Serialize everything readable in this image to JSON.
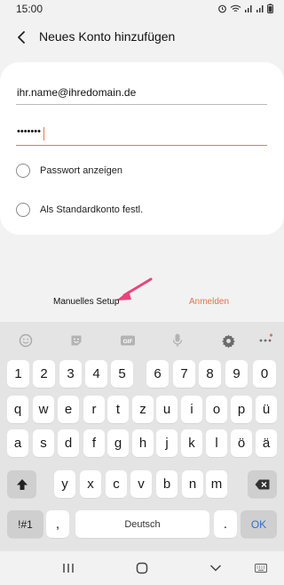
{
  "status_bar": {
    "time": "15:00"
  },
  "header": {
    "title": "Neues Konto hinzufügen"
  },
  "form": {
    "email_value": "ihr.name@ihredomain.de",
    "password_mask": "•••••••",
    "show_password_label": "Passwort anzeigen",
    "default_account_label": "Als Standardkonto festl.",
    "show_password_checked": false,
    "default_account_checked": false
  },
  "actions": {
    "manual_setup": "Manuelles Setup",
    "sign_in": "Anmelden"
  },
  "keyboard": {
    "toolbar": [
      "emoji-icon",
      "sticker-icon",
      "gif-icon",
      "microphone-icon",
      "gear-icon",
      "more-icon"
    ],
    "row_numbers": [
      "1",
      "2",
      "3",
      "4",
      "5",
      "6",
      "7",
      "8",
      "9",
      "0"
    ],
    "row_1": [
      "q",
      "w",
      "e",
      "r",
      "t",
      "z",
      "u",
      "i",
      "o",
      "p",
      "ü"
    ],
    "row_2": [
      "a",
      "s",
      "d",
      "f",
      "g",
      "h",
      "j",
      "k",
      "l",
      "ö",
      "ä"
    ],
    "row_3": [
      "y",
      "x",
      "c",
      "v",
      "b",
      "n",
      "m"
    ],
    "symbols_key": "!#1",
    "comma_key": ",",
    "space_label": "Deutsch",
    "period_key": ".",
    "ok_key": "OK"
  },
  "colors": {
    "accent": "#e07448",
    "ok_blue": "#2f6fcc",
    "annotation_arrow": "#e8457a"
  }
}
